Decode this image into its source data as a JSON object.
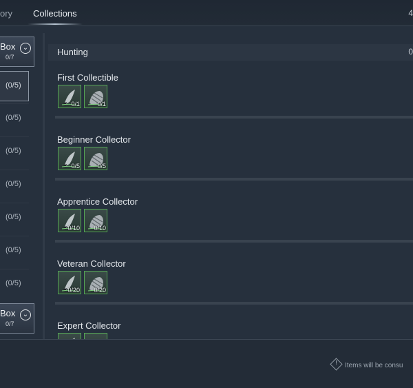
{
  "header": {
    "tab_partial": "ory",
    "tab_active": "Collections",
    "count_partial": "4"
  },
  "sidebar": {
    "box_top": {
      "label": "Box",
      "count": "0/7"
    },
    "box_bottom": {
      "label": "Box",
      "count": "0/7"
    },
    "items": [
      "(0/5)",
      "(0/5)",
      "(0/5)",
      "(0/5)",
      "(0/5)",
      "(0/5)",
      "(0/5)"
    ]
  },
  "main": {
    "category_title": "Hunting",
    "category_count": "0",
    "sections": [
      {
        "title": "First Collectible",
        "qty1": "0/1",
        "qty2": "0/1"
      },
      {
        "title": "Beginner Collector",
        "qty1": "0/5",
        "qty2": "0/5"
      },
      {
        "title": "Apprentice Collector",
        "qty1": "0/10",
        "qty2": "0/10"
      },
      {
        "title": "Veteran Collector",
        "qty1": "0/20",
        "qty2": "0/20"
      },
      {
        "title": "Expert Collector",
        "qty1": "",
        "qty2": ""
      }
    ]
  },
  "footer": {
    "notice": "Items will be consu"
  },
  "icons": {
    "chevron": "chevron-down-icon",
    "item1": "bird-feather-icon",
    "item2": "beast-hide-icon",
    "notice": "warning-diamond-icon"
  },
  "colors": {
    "item_border": "#55a655",
    "background": "#26303d"
  }
}
